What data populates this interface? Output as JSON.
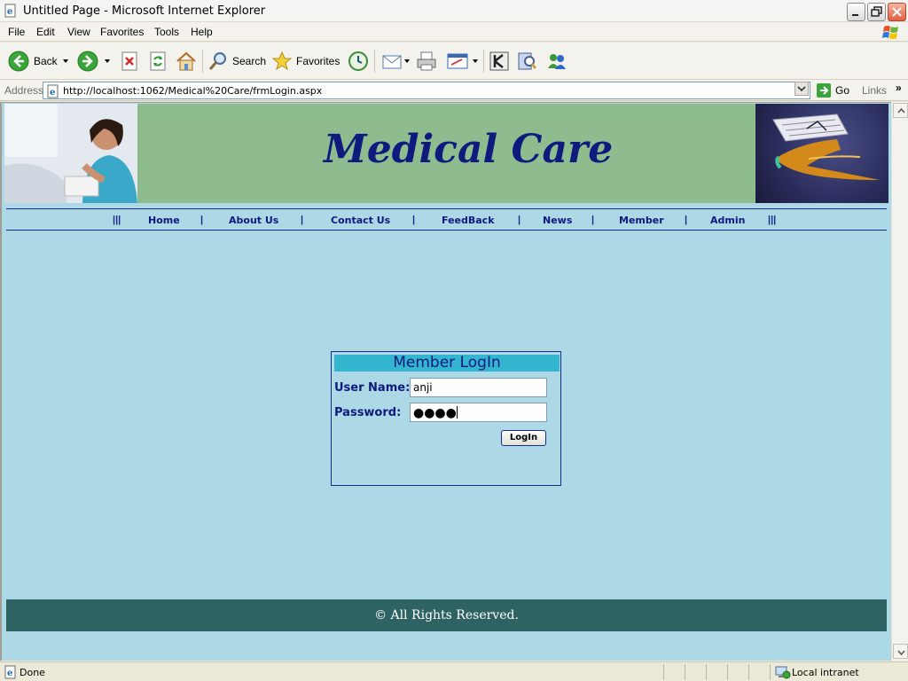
{
  "window": {
    "title": "Untitled Page - Microsoft Internet Explorer"
  },
  "menu": [
    "File",
    "Edit",
    "View",
    "Favorites",
    "Tools",
    "Help"
  ],
  "toolbar": {
    "back_label": "Back",
    "search_label": "Search",
    "favorites_label": "Favorites"
  },
  "address": {
    "label": "Address",
    "url": "http://localhost:1062/Medical%20Care/frmLogin.aspx",
    "go_label": "Go",
    "links_label": "Links"
  },
  "banner": {
    "brand": "Medical Care"
  },
  "nav": {
    "left_pipes": "|||",
    "right_pipes": "|||",
    "items": [
      {
        "label": "Home"
      },
      {
        "label": "About Us"
      },
      {
        "label": "Contact Us"
      },
      {
        "label": "FeedBack"
      },
      {
        "label": "News"
      },
      {
        "label": "Member"
      },
      {
        "label": "Admin"
      }
    ]
  },
  "login": {
    "title": "Member LogIn",
    "username_label": "User Name:",
    "username_value": "anji",
    "password_label": "Password:",
    "password_mask": "●●●●",
    "button_label": "LogIn"
  },
  "footer": {
    "text": "© All Rights Reserved."
  },
  "status": {
    "text": "Done",
    "zone": "Local intranet"
  },
  "colors": {
    "page_bg": "#add8e6",
    "banner_bg": "#8fbc8f",
    "brand_text": "#0e1a7d",
    "login_header": "#33b5d0",
    "footer_bg": "#2f6262"
  }
}
